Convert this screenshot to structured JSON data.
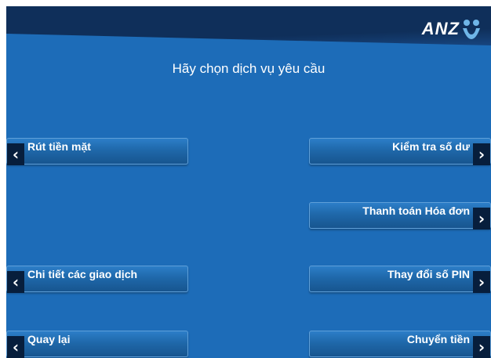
{
  "brand": {
    "logo_text": "ANZ",
    "logo_icon": "anz-person-icon"
  },
  "prompt": "Hãy chọn dịch vụ yêu cầu",
  "options": {
    "left": [
      {
        "label": "Rút tiền mặt",
        "arrow": "‹"
      },
      {
        "label": "Chi tiết các giao dịch",
        "arrow": "‹"
      },
      {
        "label": "Quay lại",
        "arrow": "‹"
      }
    ],
    "right": [
      {
        "label": "Kiểm tra số dư",
        "arrow": "›"
      },
      {
        "label": "Thanh toán Hóa đơn",
        "arrow": "›"
      },
      {
        "label": "Thay đổi số PIN",
        "arrow": "›"
      },
      {
        "label": "Chuyển tiền",
        "arrow": "›"
      }
    ]
  },
  "colors": {
    "background": "#1d6cb8",
    "header": "#0f2f5a",
    "arrow_block": "#071e3c",
    "logo_accent": "#6fb6e8"
  }
}
